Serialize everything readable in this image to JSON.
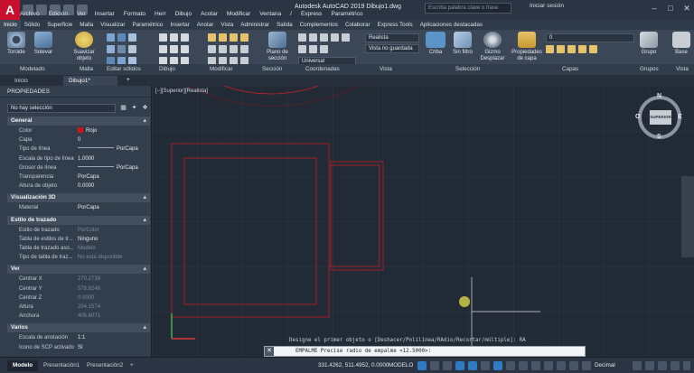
{
  "window": {
    "title": "Autodesk AutoCAD 2019    Dibujo1.dwg",
    "search_placeholder": "Escriba palabra clave o frase",
    "login_label": "Iniciar sesión",
    "app_logo": "A"
  },
  "menubar": [
    "Archivo",
    "Edición",
    "Ver",
    "Insertar",
    "Formato",
    "Herr",
    "Dibujo",
    "Acotar",
    "Modificar",
    "Ventana",
    "/",
    "Express",
    "Paramétrico"
  ],
  "ribbon_tabs": [
    "Inicio",
    "Sólido",
    "Superficie",
    "Malla",
    "Visualizar",
    "Paramétrico",
    "Insertar",
    "Anotar",
    "Vista",
    "Administrar",
    "Salida",
    "Complementos",
    "Colaborar",
    "Express Tools",
    "Aplicaciones destacadas"
  ],
  "ribbon_buttons": {
    "toroide": "Toroide",
    "solevar": "Solevar",
    "suavizar": "Suavizar objeto",
    "plano_seccion": "Plano de sección",
    "criba": "Criba",
    "sin_filtro": "Sin filtro",
    "gizmo": "Gizmo Desplazar",
    "propiedades_capa": "Propiedades de capa",
    "grupo": "Grupo",
    "base": "Base"
  },
  "ribbon_dropdowns": {
    "visual_style": "Realista",
    "named_view": "Vista no guardada",
    "ucs": "Universal",
    "layer": "0"
  },
  "ribbon_panels": [
    "Modelado",
    "Malla",
    "Editar sólidos",
    "Dibujo",
    "Modificar",
    "Sección",
    "Coordenadas",
    "Vista",
    "Selección",
    "Capas",
    "Grupos",
    "Vista"
  ],
  "file_tabs": [
    "Inicio",
    "Dibujo1*"
  ],
  "properties": {
    "title": "PROPIEDADES",
    "selection": "No hay selección",
    "sections": [
      {
        "name": "General",
        "rows": [
          {
            "k": "Color",
            "v": "Rojo",
            "swatch": true
          },
          {
            "k": "Capa",
            "v": "0"
          },
          {
            "k": "Tipo de línea",
            "v": "PorCapa",
            "line": true
          },
          {
            "k": "Escala de tipo de línea",
            "v": "1.0000"
          },
          {
            "k": "Grosor de línea",
            "v": "PorCapa",
            "line": true
          },
          {
            "k": "Transparencia",
            "v": "PorCapa"
          },
          {
            "k": "Altura de objeto",
            "v": "0.0000"
          }
        ]
      },
      {
        "name": "Visualización 3D",
        "rows": [
          {
            "k": "Material",
            "v": "PorCapa"
          }
        ]
      },
      {
        "name": "Estilo de trazado",
        "rows": [
          {
            "k": "Estilo de trazado",
            "v": "PorColor",
            "dim": true
          },
          {
            "k": "Tabla de estilos de tr...",
            "v": "Ninguno"
          },
          {
            "k": "Tabla de trazado aso...",
            "v": "Modelo",
            "dim": true
          },
          {
            "k": "Tipo de tabla de traz...",
            "v": "No está disponible",
            "dim": true
          }
        ]
      },
      {
        "name": "Ver",
        "rows": [
          {
            "k": "Centrar X",
            "v": "270.2739",
            "dim": true
          },
          {
            "k": "Centrar Y",
            "v": "578.8246",
            "dim": true
          },
          {
            "k": "Centrar Z",
            "v": "0.0000",
            "dim": true
          },
          {
            "k": "Altura",
            "v": "204.1574",
            "dim": true
          },
          {
            "k": "Anchura",
            "v": "405.6071",
            "dim": true
          }
        ]
      },
      {
        "name": "Varios",
        "rows": [
          {
            "k": "Escala de anotación",
            "v": "1:1"
          },
          {
            "k": "Icono de SCP activado",
            "v": "Sí"
          }
        ]
      }
    ]
  },
  "viewport": {
    "label": "[−][Superior][Realista]",
    "viewcube_face": "SUPERIOR",
    "viewcube_n": "N",
    "viewcube_s": "S",
    "viewcube_e": "E",
    "viewcube_o": "O"
  },
  "command": {
    "history": "Designe el primer objeto o [Deshacer/Polilínea/RAdio/Recortar/múltiple]: RA",
    "current": "EMPALME Precise radio de empalme <12.5000>:"
  },
  "status": {
    "layout_tabs": [
      "Modelo",
      "Presentación1",
      "Presentación2"
    ],
    "add_tab": "+",
    "coords": "331.4262, 511.4952, 0.0000",
    "model": "MODELO",
    "units": "Decimal"
  },
  "colors": {
    "drawing_lines": "#c41e25",
    "canvas_bg": "#212a35"
  }
}
